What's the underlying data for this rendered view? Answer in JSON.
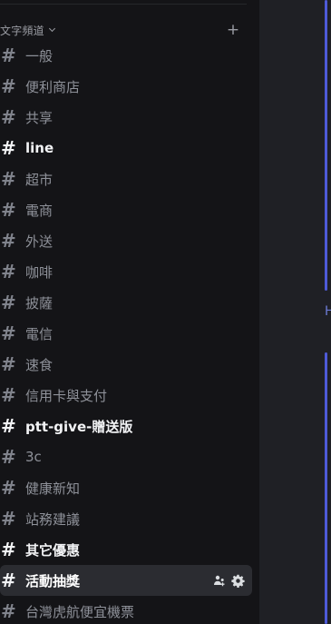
{
  "category": {
    "label": "文字頻道",
    "add_label": "+"
  },
  "channels": [
    {
      "name": "一般",
      "state": "normal"
    },
    {
      "name": "便利商店",
      "state": "normal"
    },
    {
      "name": "共享",
      "state": "normal"
    },
    {
      "name": "line",
      "state": "unread"
    },
    {
      "name": "超市",
      "state": "normal"
    },
    {
      "name": "電商",
      "state": "normal"
    },
    {
      "name": "外送",
      "state": "normal"
    },
    {
      "name": "咖啡",
      "state": "normal"
    },
    {
      "name": "披薩",
      "state": "normal"
    },
    {
      "name": "電信",
      "state": "normal"
    },
    {
      "name": "速食",
      "state": "normal"
    },
    {
      "name": "信用卡與支付",
      "state": "normal"
    },
    {
      "name": "ptt-give-贈送版",
      "state": "unread"
    },
    {
      "name": "3c",
      "state": "normal"
    },
    {
      "name": "健康新知",
      "state": "normal"
    },
    {
      "name": "站務建議",
      "state": "normal"
    },
    {
      "name": "其它優惠",
      "state": "unread"
    },
    {
      "name": "活動抽獎",
      "state": "active"
    },
    {
      "name": "台灣虎航便宜機票",
      "state": "normal"
    }
  ],
  "hash_symbol": "#",
  "active_channel_icons": [
    "add-member-icon",
    "gear-icon"
  ],
  "edge_text": "Hi",
  "colors": {
    "sidebar_bg": "#141417",
    "main_bg": "#1f2025",
    "active_bg": "#2b2c31",
    "accent": "#4e5ad8",
    "muted_text": "#8e9199",
    "bright_text": "#f2f3f5"
  }
}
